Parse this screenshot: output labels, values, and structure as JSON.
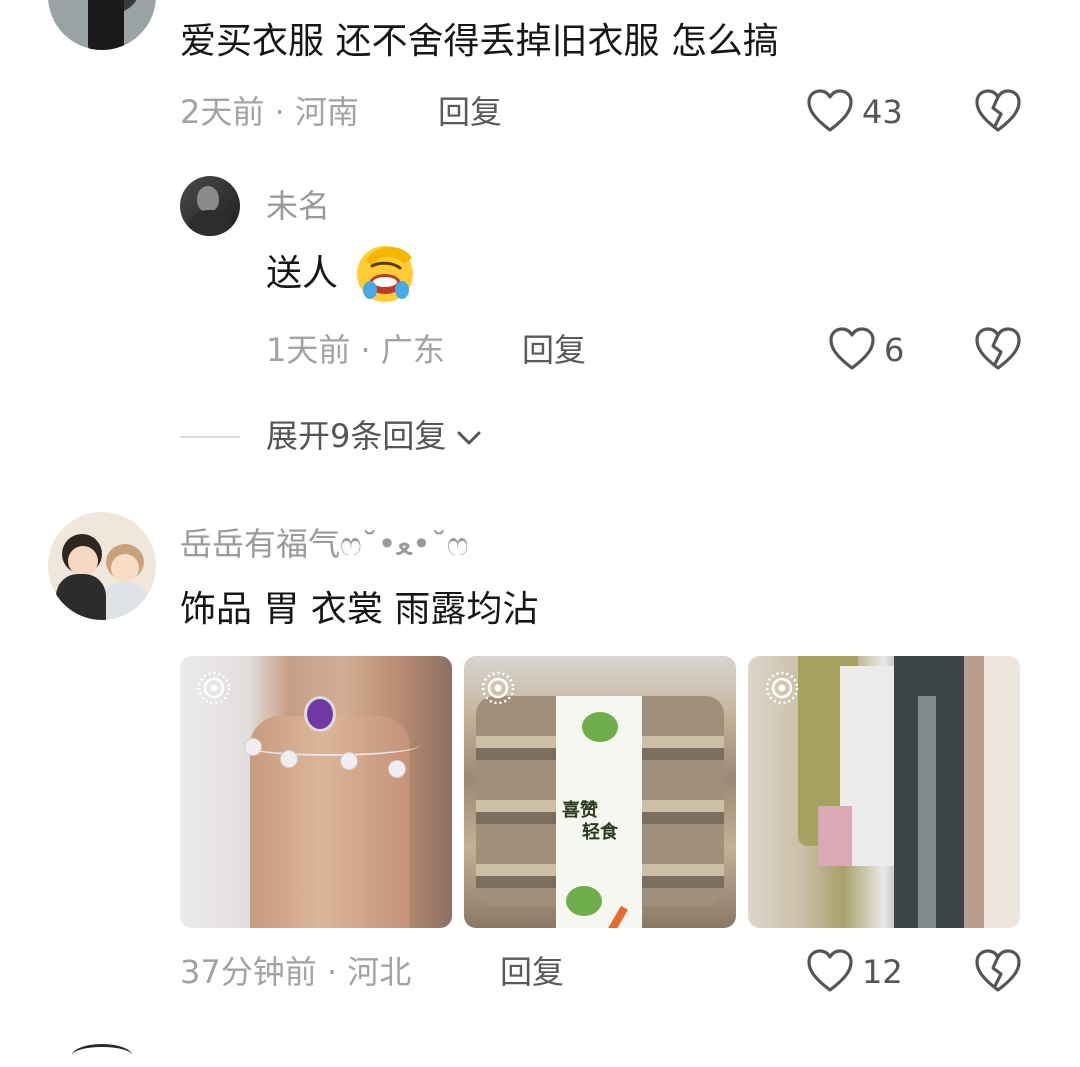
{
  "comments": [
    {
      "text": "爱买衣服 还不舍得丢掉旧衣服 怎么搞",
      "meta": "2天前 · 河南",
      "reply_label": "回复",
      "likes": "43"
    }
  ],
  "reply": {
    "username": "未名",
    "text": "送人",
    "emoji_icon": "facepalm-laughing-emoji",
    "meta": "1天前 · 广东",
    "reply_label": "回复",
    "likes": "6"
  },
  "expand": {
    "label": "展开9条回复"
  },
  "comment3": {
    "username": "岳岳有福气ෆ˘•ﻌ•˘ෆ",
    "text": "饰品 胃 衣裳 雨露均沾",
    "photos": [
      "jewelry-anklet-photo",
      "sandwich-box-photo",
      "clothes-rack-photo"
    ],
    "photo_label_line1": "喜赞",
    "photo_label_line2": "轻食",
    "meta": "37分钟前 · 河北",
    "reply_label": "回复",
    "likes": "12"
  },
  "colors": {
    "text_primary": "#161616",
    "text_meta": "#a3a3a3",
    "icon_gray": "#555555"
  }
}
